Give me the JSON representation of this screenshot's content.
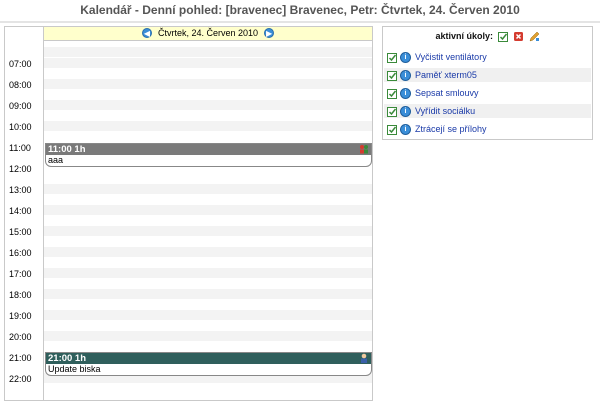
{
  "title": "Kalendář - Denní pohled: [bravenec] Bravenec, Petr: Čtvrtek, 24. Červen 2010",
  "calendar": {
    "day_label": "Čtvrtek, 24. Červen 2010",
    "hours": [
      "07:00",
      "08:00",
      "09:00",
      "10:00",
      "11:00",
      "12:00",
      "13:00",
      "14:00",
      "15:00",
      "16:00",
      "17:00",
      "18:00",
      "19:00",
      "20:00",
      "21:00",
      "22:00"
    ],
    "events": [
      {
        "header": "11:00 1h",
        "text": "aaa",
        "color": "#7a7a7a"
      },
      {
        "header": "21:00 1h",
        "text": "Update biska",
        "color": "#2f5f5c"
      }
    ]
  },
  "tasks": {
    "header": "aktivní úkoly:",
    "items": [
      {
        "label": "Vyčistit ventilátory"
      },
      {
        "label": "Paměť xterm05"
      },
      {
        "label": "Sepsat smlouvy"
      },
      {
        "label": "Vyřídit sociálku"
      },
      {
        "label": "Ztrácejí se přílohy"
      }
    ]
  }
}
